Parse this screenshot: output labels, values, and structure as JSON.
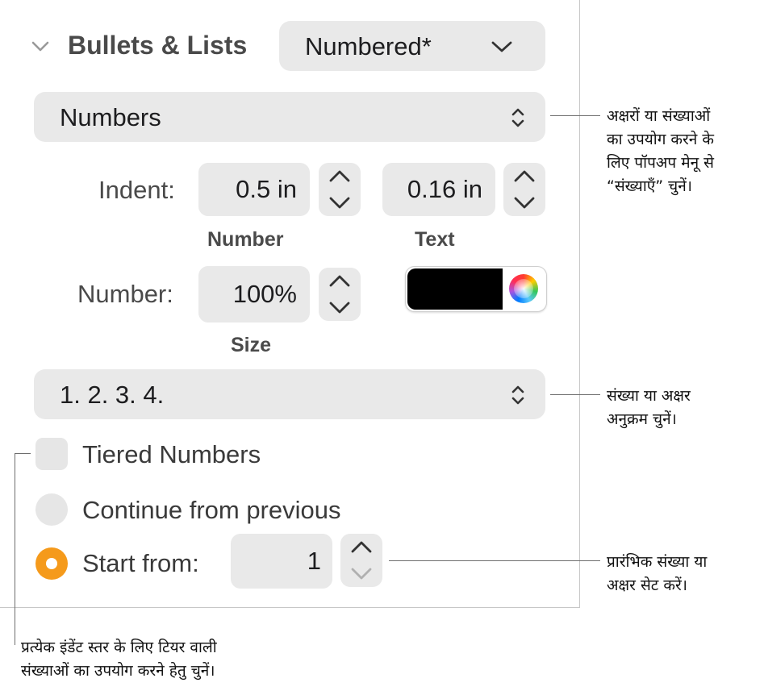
{
  "section": {
    "title": "Bullets & Lists",
    "preset_value": "Numbered*"
  },
  "list_type": {
    "value": "Numbers"
  },
  "indent": {
    "label": "Indent:",
    "number_value": "0.5 in",
    "number_caption": "Number",
    "text_value": "0.16 in",
    "text_caption": "Text"
  },
  "number_size": {
    "label": "Number:",
    "value": "100%",
    "caption": "Size",
    "color": "#000000"
  },
  "sequence": {
    "value": "1. 2. 3. 4."
  },
  "options": {
    "tiered_label": "Tiered Numbers",
    "tiered_checked": false,
    "continue_label": "Continue from previous",
    "start_label": "Start from:",
    "start_value": "1",
    "selected": "start"
  },
  "callouts": {
    "list_type": [
      "अक्षरों या संख्याओं",
      "का उपयोग करने के",
      "लिए पॉपअप मेनू से",
      "“संख्याएँ” चुनें।"
    ],
    "sequence": [
      "संख्या या अक्षर",
      "अनुक्रम चुनें।"
    ],
    "start": [
      "प्रारंभिक संख्या या",
      "अक्षर सेट करें।"
    ],
    "tiered": [
      "प्रत्येक इंडेंट स्तर के लिए टियर वाली",
      "संख्याओं का उपयोग करने हेतु चुनें।"
    ]
  }
}
